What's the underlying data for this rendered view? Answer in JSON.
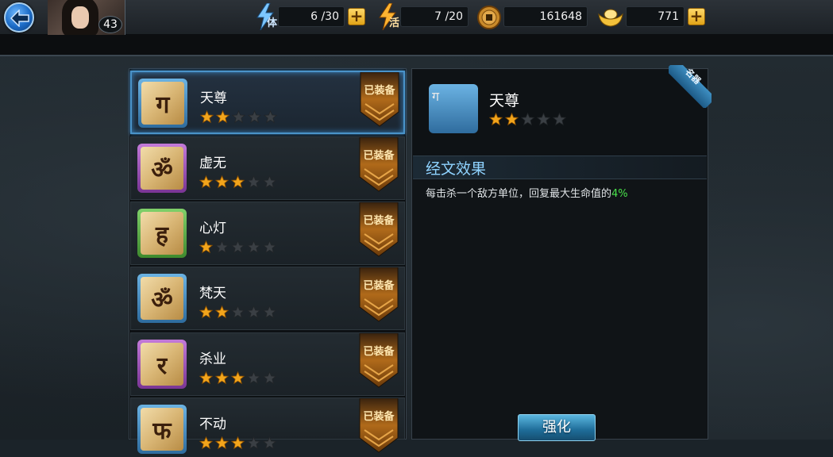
{
  "player": {
    "level": "43"
  },
  "stats": {
    "stamina": {
      "icon": "lightning-stamina-icon",
      "icon_label": "体",
      "value": "6 /30"
    },
    "activity": {
      "icon": "lightning-activity-icon",
      "icon_label": "活",
      "value": "7 /20"
    },
    "copper": {
      "icon": "copper-coin-icon",
      "value": "161648"
    },
    "gold": {
      "icon": "gold-ingot-icon",
      "value": "771"
    }
  },
  "scriptures": [
    {
      "name": "天尊",
      "glyph": "ग",
      "quality": "blue",
      "stars": 2,
      "max_stars": 5,
      "badge": "已装备"
    },
    {
      "name": "虚无",
      "glyph": "ॐ",
      "quality": "purple",
      "stars": 3,
      "max_stars": 5,
      "badge": "已装备"
    },
    {
      "name": "心灯",
      "glyph": "ह",
      "quality": "green",
      "stars": 1,
      "max_stars": 5,
      "badge": "已装备"
    },
    {
      "name": "梵天",
      "glyph": "ॐ",
      "quality": "blue",
      "stars": 2,
      "max_stars": 5,
      "badge": "已装备"
    },
    {
      "name": "杀业",
      "glyph": "र",
      "quality": "purple",
      "stars": 3,
      "max_stars": 5,
      "badge": "已装备"
    },
    {
      "name": "不动",
      "glyph": "फ",
      "quality": "blue",
      "stars": 3,
      "max_stars": 5,
      "badge": "已装备"
    }
  ],
  "detail": {
    "name": "天尊",
    "glyph": "ग",
    "stars": 2,
    "max_stars": 5,
    "ribbon": "名器",
    "section_title": "经文效果",
    "effect_text": "每击杀一个敌方单位，回复最大生命值的",
    "effect_value": "4%",
    "upgrade_label": "强化"
  },
  "colors": {
    "star_on": "#f2a51c",
    "star_off": "#3a3f44",
    "badge_bg": "#b06a1a",
    "accent_blue": "#4a93c9",
    "effect_green": "#48e34a"
  }
}
